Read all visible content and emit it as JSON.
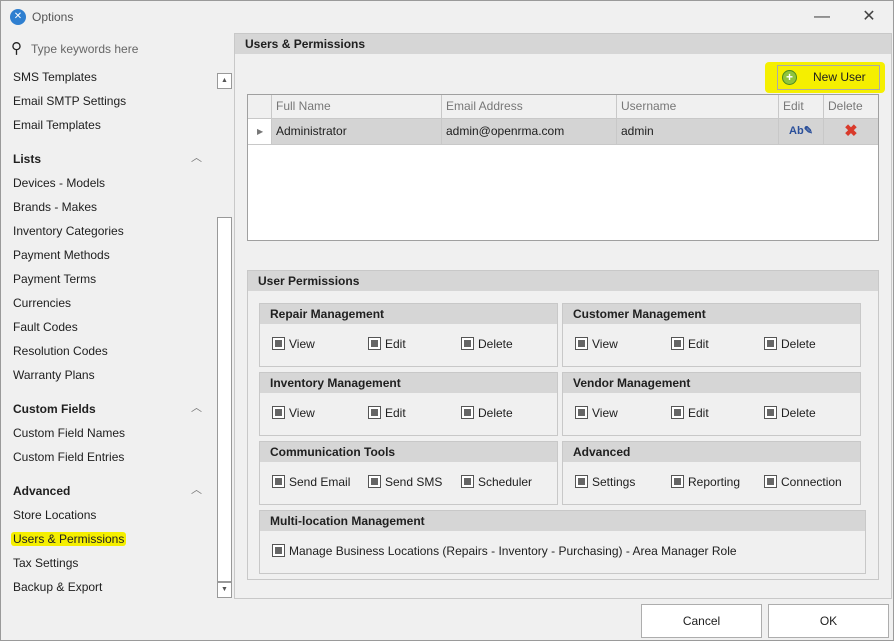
{
  "window": {
    "title": "Options",
    "icon": "tools-icon"
  },
  "sidebar": {
    "search_placeholder": "Type keywords here",
    "items_top": [
      "SMS Templates",
      "Email SMTP Settings",
      "Email Templates"
    ],
    "groups": [
      {
        "title": "Lists",
        "items": [
          "Devices - Models",
          "Brands - Makes",
          "Inventory Categories",
          "Payment Methods",
          "Payment Terms",
          "Currencies",
          "Fault Codes",
          "Resolution Codes",
          "Warranty Plans"
        ]
      },
      {
        "title": "Custom Fields",
        "items": [
          "Custom Field Names",
          "Custom Field Entries"
        ]
      },
      {
        "title": "Advanced",
        "items": [
          "Store Locations",
          "Users & Permissions",
          "Tax Settings",
          "Backup & Export"
        ]
      }
    ],
    "selected": "Users & Permissions",
    "highlight_color": "#f5ef00"
  },
  "main": {
    "title": "Users & Permissions",
    "new_user_label": "New User",
    "grid": {
      "columns": [
        "Full Name",
        "Email Address",
        "Username",
        "Edit",
        "Delete"
      ],
      "rows": [
        {
          "full_name": "Administrator",
          "email": "admin@openrma.com",
          "username": "admin"
        }
      ]
    },
    "permissions": {
      "title": "User Permissions",
      "groups": [
        {
          "title": "Repair Management",
          "options": [
            "View",
            "Edit",
            "Delete"
          ]
        },
        {
          "title": "Customer Management",
          "options": [
            "View",
            "Edit",
            "Delete"
          ]
        },
        {
          "title": "Inventory Management",
          "options": [
            "View",
            "Edit",
            "Delete"
          ]
        },
        {
          "title": "Vendor Management",
          "options": [
            "View",
            "Edit",
            "Delete"
          ]
        },
        {
          "title": "Communication Tools",
          "options": [
            "Send Email",
            "Send SMS",
            "Scheduler"
          ]
        },
        {
          "title": "Advanced",
          "options": [
            "Settings",
            "Reporting",
            "Connection"
          ]
        },
        {
          "title": "Multi-location Management",
          "options": [
            "Manage Business Locations (Repairs - Inventory - Purchasing) - Area Manager Role"
          ]
        }
      ],
      "checkbox_state": "indeterminate"
    }
  },
  "footer": {
    "cancel_label": "Cancel",
    "ok_label": "OK"
  }
}
